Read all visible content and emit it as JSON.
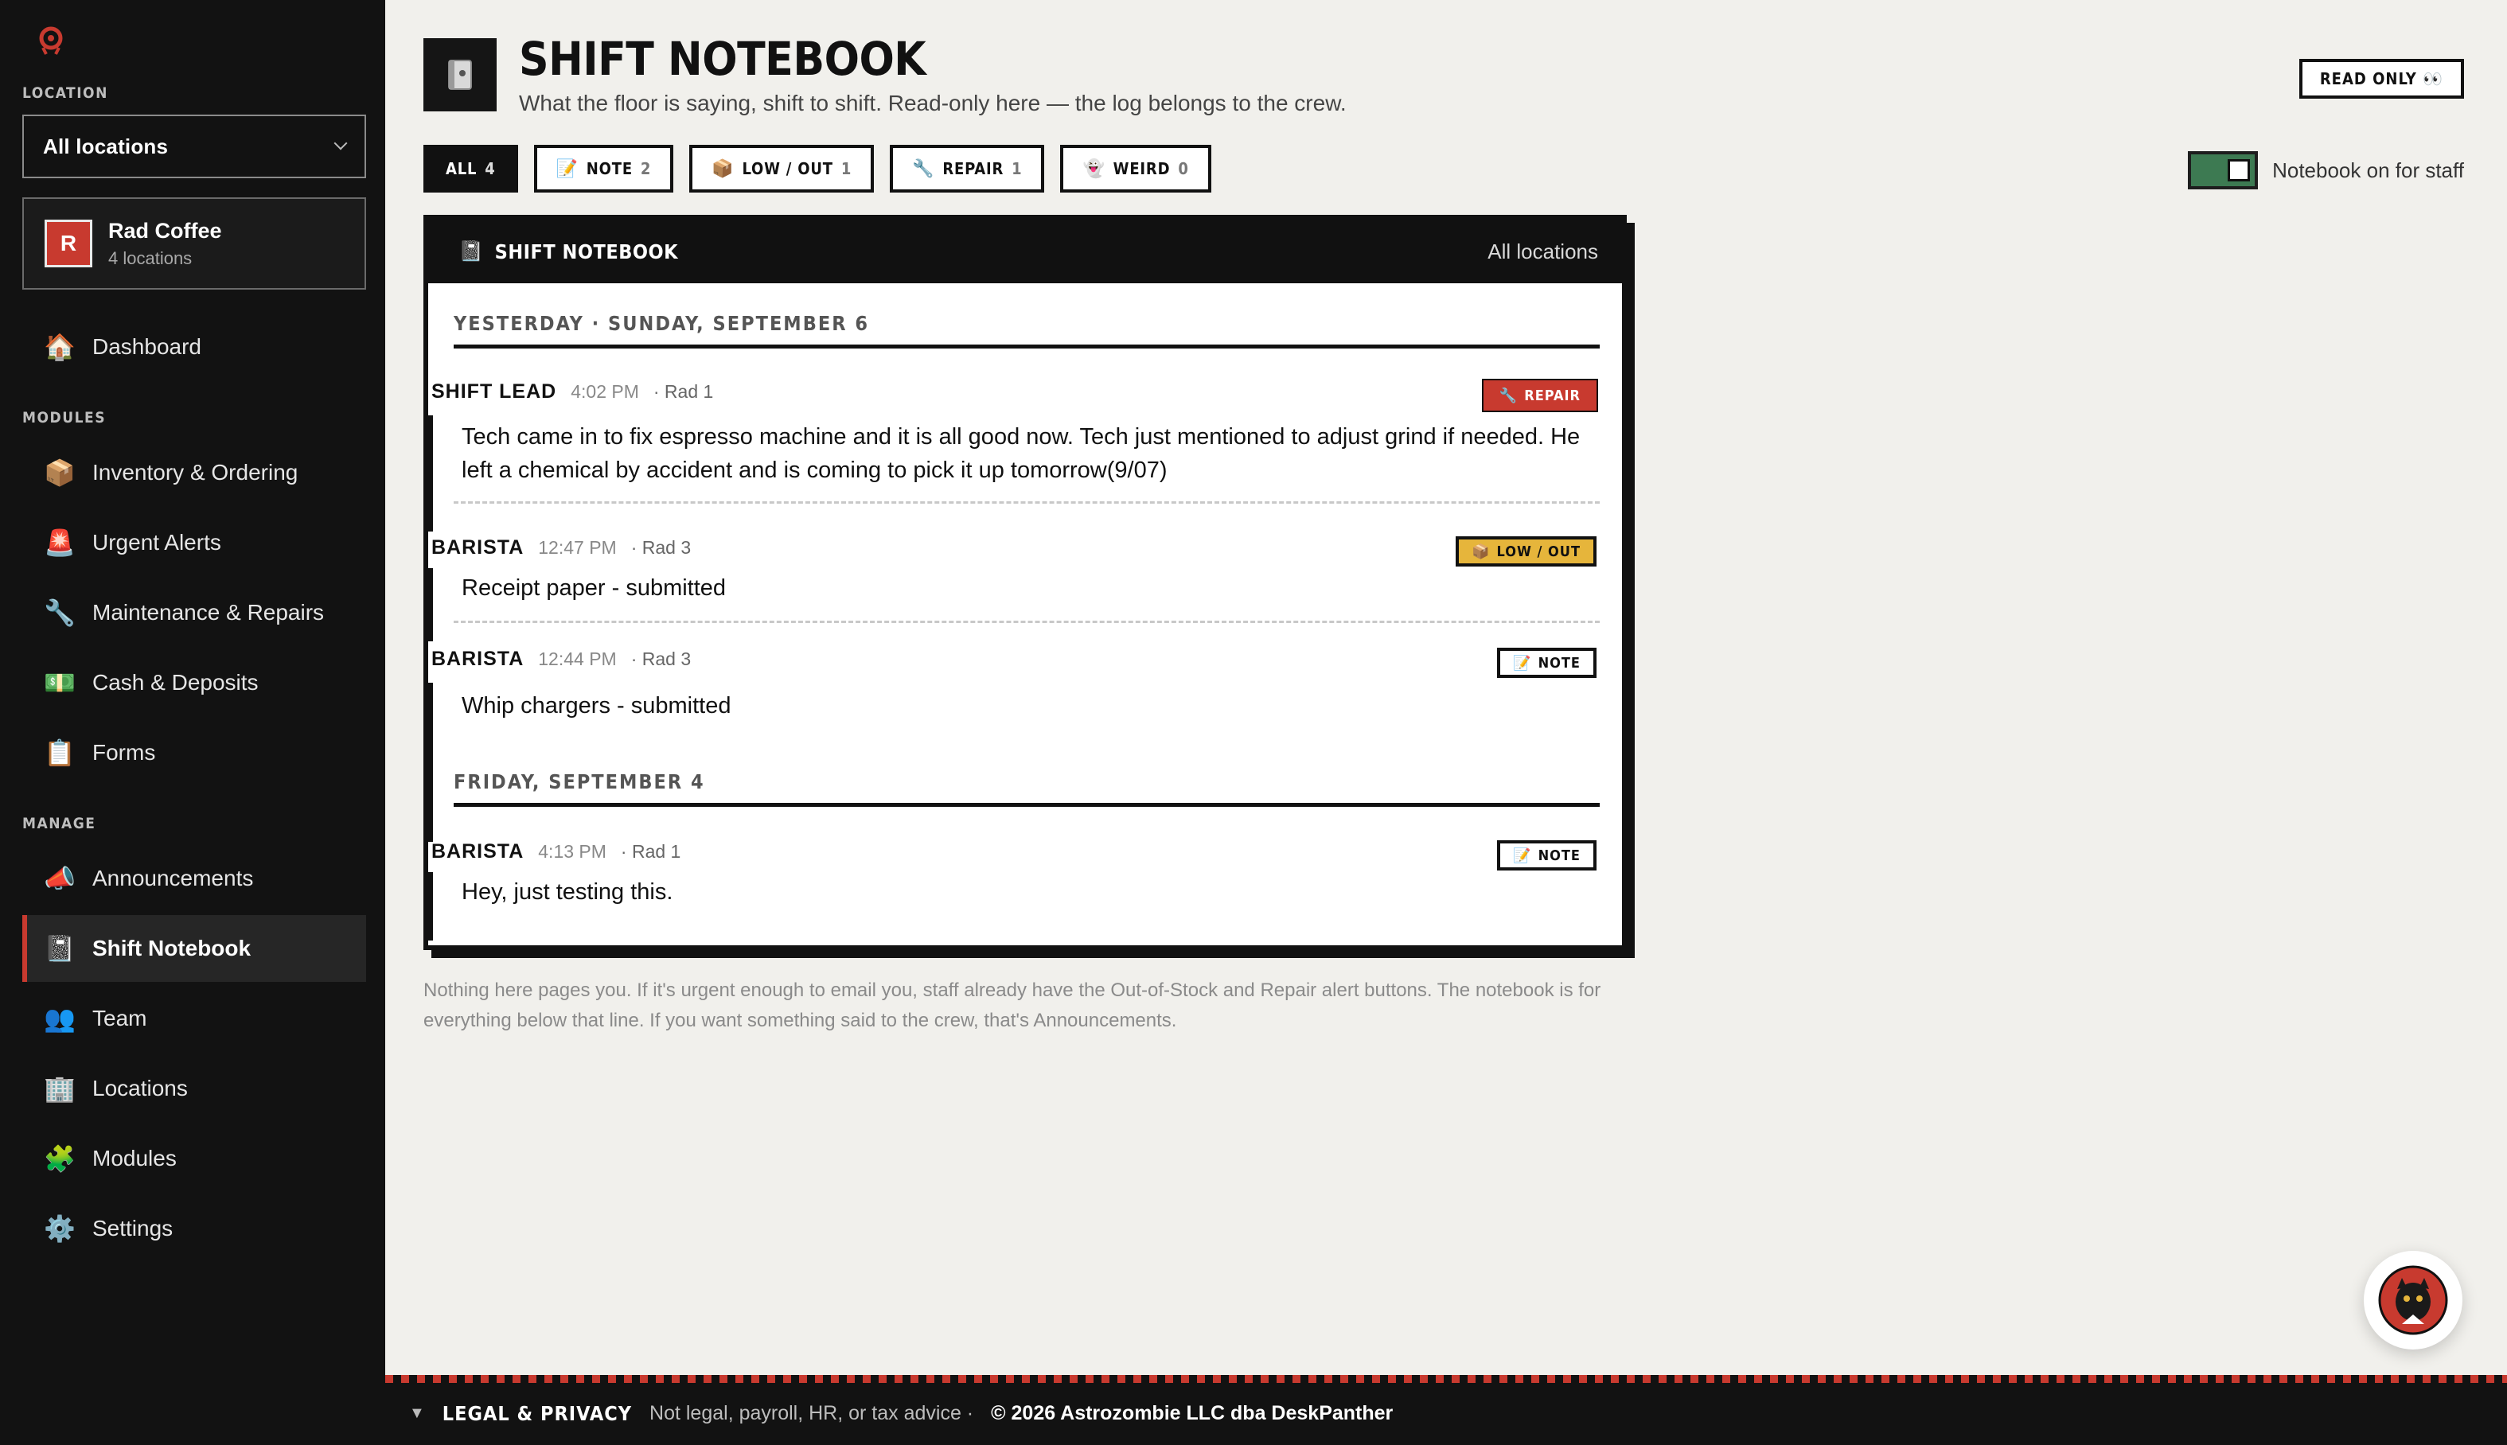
{
  "sidebar": {
    "location_label": "LOCATION",
    "location_select": "All locations",
    "org": {
      "initial": "R",
      "name": "Rad Coffee",
      "sub": "4 locations"
    },
    "dashboard": {
      "label": "Dashboard",
      "icon": "house-icon"
    },
    "modules_label": "MODULES",
    "modules": [
      {
        "label": "Inventory & Ordering",
        "icon": "package-icon"
      },
      {
        "label": "Urgent Alerts",
        "icon": "siren-icon"
      },
      {
        "label": "Maintenance & Repairs",
        "icon": "wrench-icon"
      },
      {
        "label": "Cash & Deposits",
        "icon": "cash-icon"
      },
      {
        "label": "Forms",
        "icon": "clipboard-icon"
      }
    ],
    "manage_label": "MANAGE",
    "manage": [
      {
        "label": "Announcements",
        "icon": "megaphone-icon"
      },
      {
        "label": "Shift Notebook",
        "icon": "notebook-icon",
        "active": true
      },
      {
        "label": "Team",
        "icon": "people-icon"
      },
      {
        "label": "Locations",
        "icon": "building-icon"
      },
      {
        "label": "Modules",
        "icon": "puzzle-icon"
      },
      {
        "label": "Settings",
        "icon": "gear-icon"
      }
    ]
  },
  "header": {
    "title": "SHIFT NOTEBOOK",
    "subtitle": "What the floor is saying, shift to shift. Read-only here — the log belongs to the crew.",
    "read_only": "READ ONLY 👀"
  },
  "filters": [
    {
      "label": "ALL",
      "count": "4",
      "emoji": "",
      "active": true
    },
    {
      "label": "NOTE",
      "count": "2",
      "emoji": "📝"
    },
    {
      "label": "LOW / OUT",
      "count": "1",
      "emoji": "📦"
    },
    {
      "label": "REPAIR",
      "count": "1",
      "emoji": "🔧"
    },
    {
      "label": "WEIRD",
      "count": "0",
      "emoji": "👻"
    }
  ],
  "toggle": {
    "label": "Notebook on for staff",
    "on": true
  },
  "notebook": {
    "title": "SHIFT NOTEBOOK",
    "scope": "All locations",
    "days": [
      {
        "heading": "YESTERDAY · SUNDAY, SEPTEMBER 6",
        "entries": [
          {
            "who": "SHIFT LEAD",
            "time": "4:02 PM",
            "loc": "· Rad 1",
            "tag": "REPAIR",
            "tag_emoji": "🔧",
            "body": "Tech came in to fix espresso machine and it is all good now. Tech just mentioned to adjust grind if needed. He left a chemical by accident and is coming to pick it up tomorrow(9/07)"
          },
          {
            "who": "BARISTA",
            "time": "12:47 PM",
            "loc": "· Rad 3",
            "tag": "LOW / OUT",
            "tag_emoji": "📦",
            "body": "Receipt paper - submitted"
          },
          {
            "who": "BARISTA",
            "time": "12:44 PM",
            "loc": "· Rad 3",
            "tag": "NOTE",
            "tag_emoji": "📝",
            "body": "Whip chargers - submitted"
          }
        ]
      },
      {
        "heading": "FRIDAY, SEPTEMBER 4",
        "entries": [
          {
            "who": "BARISTA",
            "time": "4:13 PM",
            "loc": "· Rad 1",
            "tag": "NOTE",
            "tag_emoji": "📝",
            "body": "Hey, just testing this."
          }
        ]
      }
    ]
  },
  "footnote": "Nothing here pages you. If it's urgent enough to email you, staff already have the Out-of-Stock and Repair alert buttons. The notebook is for everything below that line. If you want something said to the crew, that's Announcements.",
  "footer": {
    "caret": "▼",
    "legal": "LEGAL & PRIVACY",
    "disclaimer": "Not legal, payroll, HR, or tax advice ·",
    "copyright": "© 2026 Astrozombie LLC dba DeskPanther"
  },
  "colors": {
    "accent": "#c83a2f",
    "toggle_on": "#3d7a52",
    "low_tag": "#e6b53b",
    "sidebar_bg": "#121212",
    "page_bg": "#f1f0ec"
  }
}
